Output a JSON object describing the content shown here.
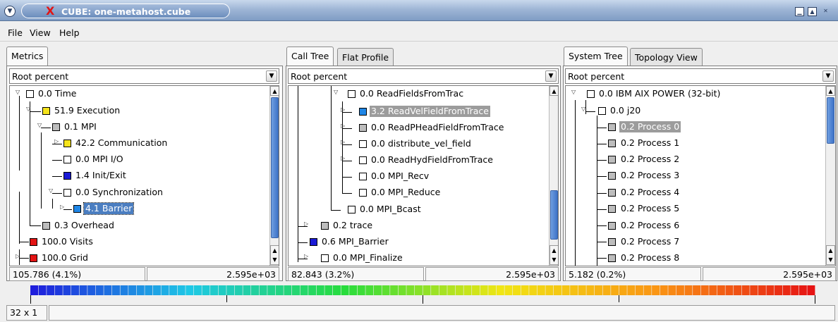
{
  "window": {
    "title": "CUBE: one-metahost.cube",
    "close_glyph": "X",
    "minimize_glyph": "▁",
    "maximize_glyph": "▲",
    "close_btn_glyph": "✕"
  },
  "menu": {
    "file": "File",
    "view": "View",
    "help": "Help"
  },
  "metrics": {
    "tab": "Metrics",
    "combo": "Root percent",
    "items": [
      {
        "label": "0.0 Time"
      },
      {
        "label": "51.9 Execution"
      },
      {
        "label": "0.1 MPI"
      },
      {
        "label": "42.2 Communication"
      },
      {
        "label": "0.0 MPI I/O"
      },
      {
        "label": "1.4 Init/Exit"
      },
      {
        "label": "0.0 Synchronization"
      },
      {
        "label": "4.1 Barrier"
      },
      {
        "label": "0.3 Overhead"
      },
      {
        "label": "100.0 Visits"
      },
      {
        "label": "100.0 Grid"
      }
    ],
    "status_left": "105.786 (4.1%)",
    "status_right": "2.595e+03"
  },
  "calltree": {
    "tabs": [
      "Call Tree",
      "Flat Profile"
    ],
    "combo": "Root percent",
    "items": [
      {
        "label": "0.0 ReadFieldsFromTrac"
      },
      {
        "label": "3.2 ReadVelFieldFromTrace"
      },
      {
        "label": "0.0 ReadPHeadFieldFromTrace"
      },
      {
        "label": "0.0 distribute_vel_field"
      },
      {
        "label": "0.0 ReadHydFieldFromTrace"
      },
      {
        "label": "0.0 MPI_Recv"
      },
      {
        "label": "0.0 MPI_Reduce"
      },
      {
        "label": "0.0 MPI_Bcast"
      },
      {
        "label": "0.2 trace"
      },
      {
        "label": "0.6 MPI_Barrier"
      },
      {
        "label": "0.0 MPI_Finalize"
      }
    ],
    "status_left": "82.843 (3.2%)",
    "status_right": "2.595e+03"
  },
  "systemtree": {
    "tabs": [
      "System Tree",
      "Topology View"
    ],
    "combo": "Root percent",
    "items": [
      {
        "label": "0.0 IBM AIX POWER (32-bit)"
      },
      {
        "label": "0.0 j20"
      },
      {
        "label": "0.2 Process 0"
      },
      {
        "label": "0.2 Process 1"
      },
      {
        "label": "0.2 Process 2"
      },
      {
        "label": "0.2 Process 3"
      },
      {
        "label": "0.2 Process 4"
      },
      {
        "label": "0.2 Process 5"
      },
      {
        "label": "0.2 Process 6"
      },
      {
        "label": "0.2 Process 7"
      },
      {
        "label": "0.2 Process 8"
      }
    ],
    "status_left": "5.182 (0.2%)",
    "status_right": "2.595e+03"
  },
  "bottom": {
    "size_label": "32 x 1"
  },
  "colors": {
    "selection": "#4b7ec1",
    "highlight": "#9c9c9c",
    "title_text": "#ffffff",
    "close_x": "#e21414"
  }
}
